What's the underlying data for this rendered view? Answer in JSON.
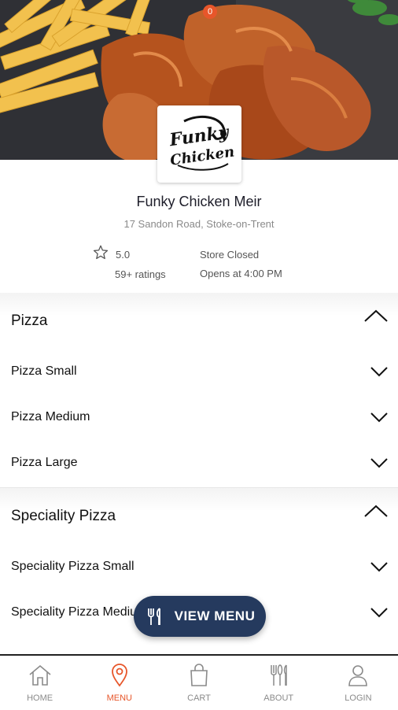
{
  "store": {
    "name": "Funky Chicken Meir",
    "address": "17 Sandon Road, Stoke-on-Trent",
    "rating": "5.0",
    "ratings_count": "59+ ratings",
    "status": "Store Closed",
    "opens": "Opens at 4:00 PM",
    "logo_text_1": "Funky",
    "logo_text_2": "Chicken"
  },
  "menu": {
    "categories": [
      {
        "title": "Pizza",
        "items": [
          "Pizza Small",
          "Pizza Medium",
          "Pizza Large"
        ]
      },
      {
        "title": "Speciality Pizza",
        "items": [
          "Speciality Pizza Small",
          "Speciality Pizza Medium"
        ]
      }
    ]
  },
  "fab": {
    "label": "VIEW MENU",
    "icon": "cutlery-icon"
  },
  "nav": {
    "items": [
      {
        "label": "HOME",
        "icon": "home-icon"
      },
      {
        "label": "MENU",
        "icon": "location-pin-icon"
      },
      {
        "label": "CART",
        "icon": "shopping-bag-icon",
        "badge": "0"
      },
      {
        "label": "ABOUT",
        "icon": "cutlery-icon"
      },
      {
        "label": "LOGIN",
        "icon": "user-icon"
      }
    ]
  },
  "colors": {
    "accent": "#e7562a",
    "fab_bg": "#253a5e",
    "text": "#111111",
    "muted": "#8a8a8a"
  }
}
